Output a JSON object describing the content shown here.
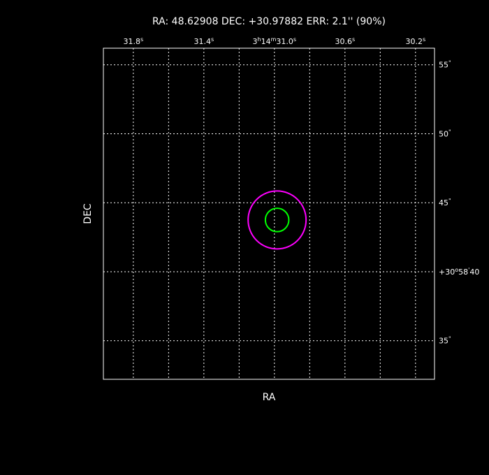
{
  "chart_data": {
    "type": "scatter",
    "title": "RA: 48.62908   DEC: +30.97882   ERR: 2.1'' (90%)",
    "xlabel": "RA",
    "ylabel": "DEC",
    "x_ticks": [
      {
        "value_s": 31.8,
        "parts": [
          {
            "t": "31.8"
          },
          {
            "t": "s",
            "sup": true
          }
        ]
      },
      {
        "value_s": 31.4,
        "parts": [
          {
            "t": "31.4"
          },
          {
            "t": "s",
            "sup": true
          }
        ]
      },
      {
        "value_s": 31.0,
        "parts": [
          {
            "t": "3"
          },
          {
            "t": "h",
            "sup": true
          },
          {
            "t": "14"
          },
          {
            "t": "m",
            "sup": true
          },
          {
            "t": "31.0"
          },
          {
            "t": "s",
            "sup": true
          }
        ]
      },
      {
        "value_s": 30.6,
        "parts": [
          {
            "t": "30.6"
          },
          {
            "t": "s",
            "sup": true
          }
        ]
      },
      {
        "value_s": 30.2,
        "parts": [
          {
            "t": "30.2"
          },
          {
            "t": "s",
            "sup": true
          }
        ]
      }
    ],
    "y_ticks": [
      {
        "value_arcsec": 55,
        "parts": [
          {
            "t": "55"
          },
          {
            "t": "\"",
            "sup": true
          }
        ]
      },
      {
        "value_arcsec": 50,
        "parts": [
          {
            "t": "50"
          },
          {
            "t": "\"",
            "sup": true
          }
        ]
      },
      {
        "value_arcsec": 45,
        "parts": [
          {
            "t": "45"
          },
          {
            "t": "\"",
            "sup": true
          }
        ]
      },
      {
        "value_arcsec": 40,
        "parts": [
          {
            "t": "+30"
          },
          {
            "t": "o",
            "sup": true
          },
          {
            "t": "58"
          },
          {
            "t": "'",
            "sup": true
          },
          {
            "t": "40"
          }
        ]
      },
      {
        "value_arcsec": 35,
        "parts": [
          {
            "t": "35"
          },
          {
            "t": "\"",
            "sup": true
          }
        ]
      }
    ],
    "x_gridlines_s": [
      31.8,
      31.6,
      31.4,
      31.2,
      31.0,
      30.8,
      30.6,
      30.4,
      30.2
    ],
    "y_gridlines_arcsec": [
      55,
      50,
      45,
      40,
      35
    ],
    "xlim_s": [
      31.9697,
      30.0923
    ],
    "ylim_arcsec": [
      56.2,
      32.2
    ],
    "grid": true,
    "circles": [
      {
        "name": "ERR",
        "ra_s": 30.9848,
        "dec_arcsec": 43.75,
        "radius_arcsec": 2.1,
        "color": "#ff00ff"
      },
      {
        "name": "source",
        "ra_s": 30.9848,
        "dec_arcsec": 43.75,
        "radius_arcsec": 0.85,
        "color": "#00ff00"
      }
    ]
  }
}
